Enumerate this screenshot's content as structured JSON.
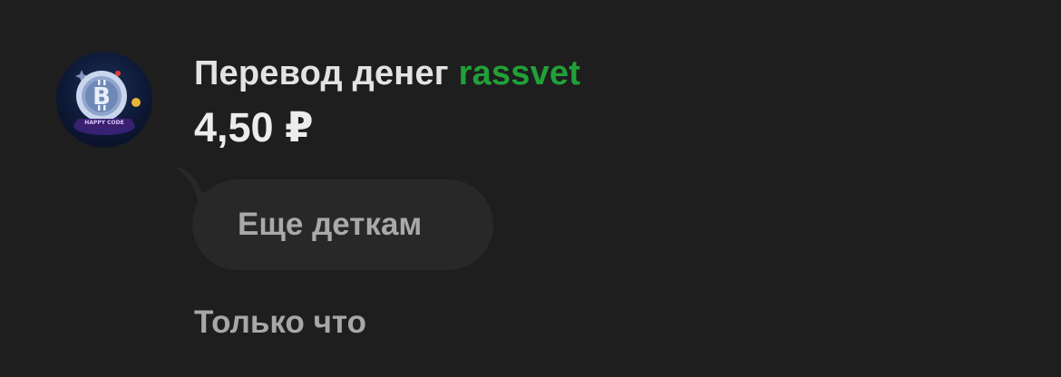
{
  "transfer": {
    "title_prefix": "Перевод денег",
    "recipient": "rassvet",
    "amount": "4,50 ₽"
  },
  "avatar": {
    "icon": "bitcoin-coin-icon",
    "caption": "HAPPY CODE"
  },
  "message": {
    "text": "Еще деткам"
  },
  "status": {
    "timestamp": "Только что"
  },
  "colors": {
    "background": "#1e1e1e",
    "recipient_accent": "#21a038",
    "bubble": "#282828"
  }
}
